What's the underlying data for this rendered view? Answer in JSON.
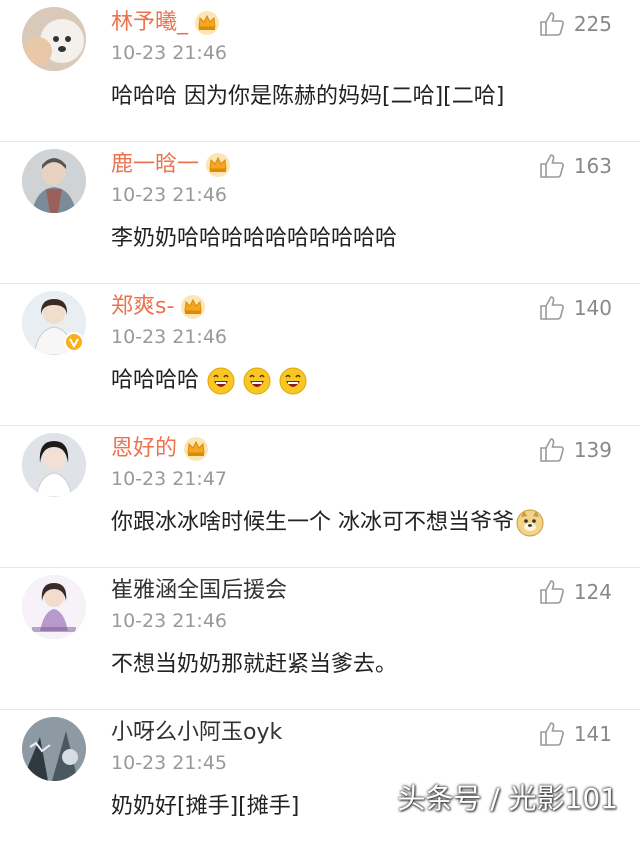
{
  "comments": [
    {
      "name": "林予曦_",
      "time": "10-23 21:46",
      "likes": "225",
      "text": "哈哈哈 因为你是陈赫的妈妈[二哈][二哈]"
    },
    {
      "name": "鹿一晗一",
      "time": "10-23 21:46",
      "likes": "163",
      "text": "李奶奶哈哈哈哈哈哈哈哈哈哈"
    },
    {
      "name": "郑爽s-",
      "time": "10-23 21:46",
      "likes": "140",
      "text": "哈哈哈哈"
    },
    {
      "name": "恩好的",
      "time": "10-23 21:47",
      "likes": "139",
      "text": "你跟冰冰啥时候生一个 冰冰可不想当爷爷"
    },
    {
      "name": "崔雅涵全国后援会",
      "time": "10-23 21:46",
      "likes": "124",
      "text": "不想当奶奶那就赶紧当爹去。"
    },
    {
      "name": "小呀么小阿玉oyk",
      "time": "10-23 21:45",
      "likes": "141",
      "text": "奶奶好[摊手][摊手]"
    }
  ],
  "watermark": "头条号 / 光影101",
  "colors": {
    "vip_name": "#eb7350",
    "plain_name": "#333333",
    "meta": "#999999",
    "crown": "#f5a623"
  },
  "icons": {
    "like": "thumbs-up-icon",
    "crown": "vip-crown-icon",
    "verified": "verified-v-icon",
    "laugh_emoji": "laughing-face-emoji",
    "doge_emoji": "doge-emoji"
  }
}
